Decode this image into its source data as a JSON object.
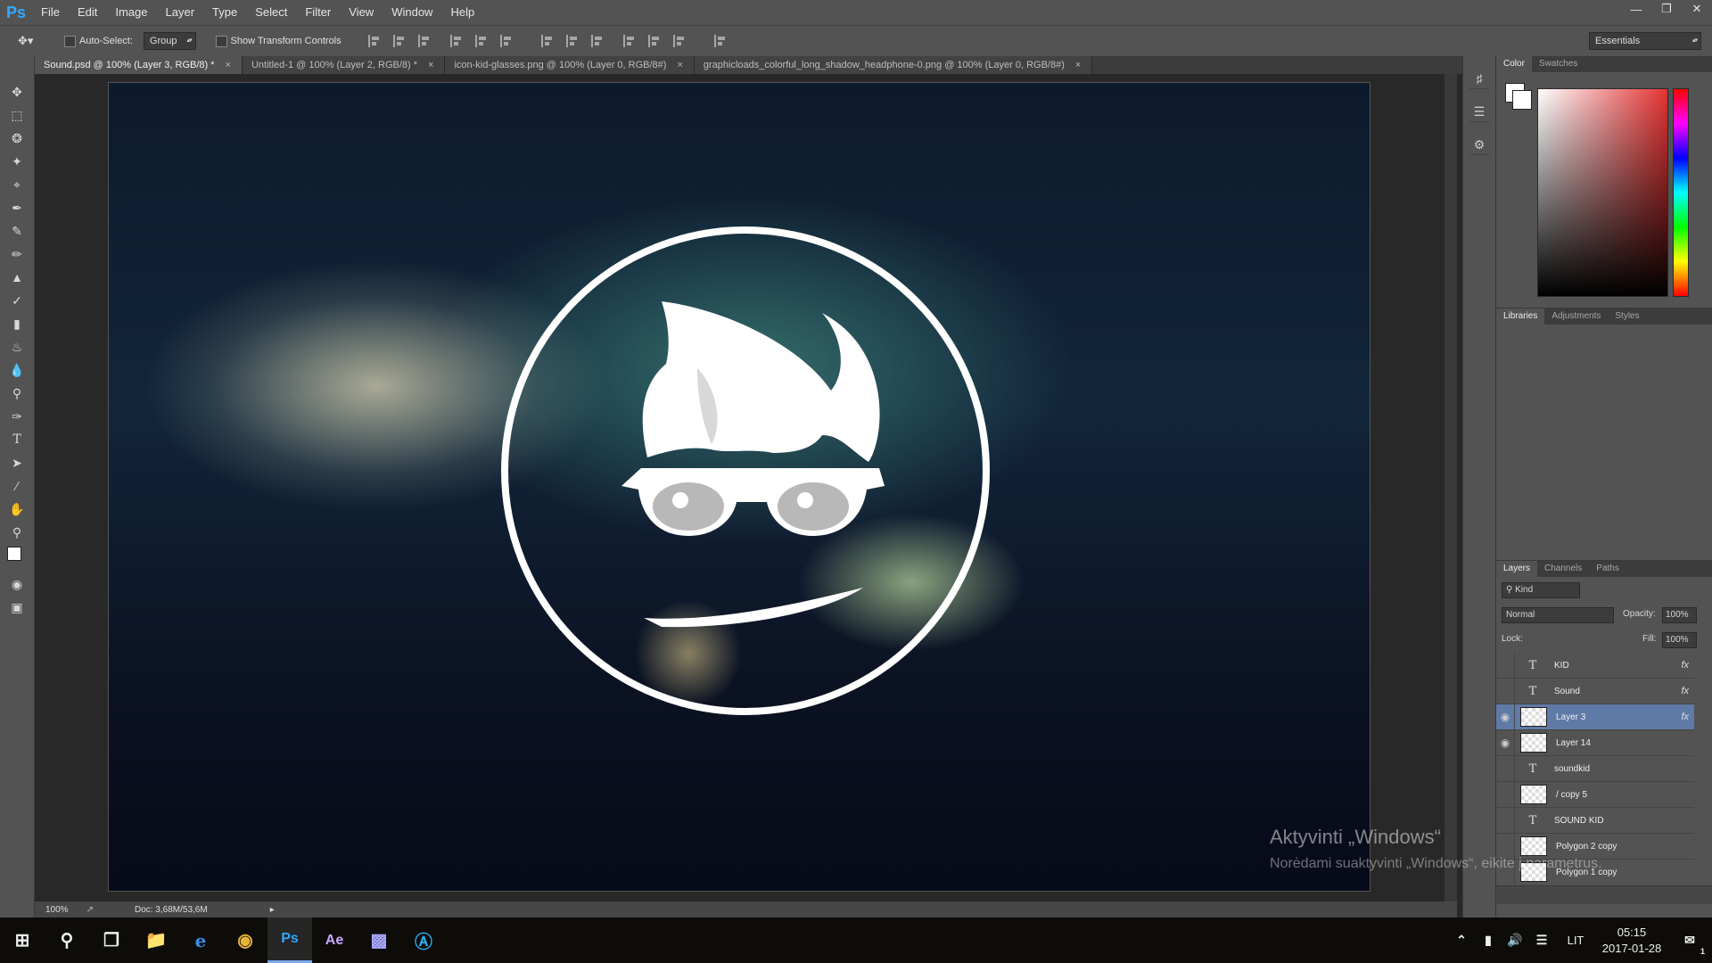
{
  "app": {
    "logo": "Ps"
  },
  "menu": [
    "File",
    "Edit",
    "Image",
    "Layer",
    "Type",
    "Select",
    "Filter",
    "View",
    "Window",
    "Help"
  ],
  "options_bar": {
    "auto_select_label": "Auto-Select:",
    "auto_select_value": "Group",
    "show_transform_label": "Show Transform Controls",
    "workspace": "Essentials"
  },
  "tabs": [
    {
      "label": "Sound.psd @ 100% (Layer 3, RGB/8) *",
      "active": true
    },
    {
      "label": "Untitled-1 @ 100% (Layer 2, RGB/8) *",
      "active": false
    },
    {
      "label": "icon-kid-glasses.png @ 100% (Layer 0, RGB/8#)",
      "active": false
    },
    {
      "label": "graphicloads_colorful_long_shadow_headphone-0.png @ 100% (Layer 0, RGB/8#)",
      "active": false
    }
  ],
  "tab_close_glyph": "×",
  "status": {
    "zoom": "100%",
    "doc": "Doc: 3,68M/53,6M"
  },
  "color_panel": {
    "tabs": [
      "Color",
      "Swatches"
    ]
  },
  "lib_panel": {
    "tabs": [
      "Libraries",
      "Adjustments",
      "Styles"
    ]
  },
  "layers_panel": {
    "tabs": [
      "Layers",
      "Channels",
      "Paths"
    ],
    "kind": "Kind",
    "blend_mode": "Normal",
    "opacity_label": "Opacity:",
    "opacity": "100%",
    "lock_label": "Lock:",
    "fill_label": "Fill:",
    "fill": "100%",
    "layers": [
      {
        "name": "KID",
        "type": "text",
        "visible": false,
        "fx": true,
        "selected": false
      },
      {
        "name": "Sound",
        "type": "text",
        "visible": false,
        "fx": true,
        "selected": false
      },
      {
        "name": "Layer 3",
        "type": "pixel",
        "visible": true,
        "fx": true,
        "selected": true
      },
      {
        "name": "Layer 14",
        "type": "pixel",
        "visible": true,
        "fx": false,
        "selected": false
      },
      {
        "name": "soundkid",
        "type": "text",
        "visible": false,
        "fx": false,
        "selected": false
      },
      {
        "name": "/ copy 5",
        "type": "pixel",
        "visible": false,
        "fx": false,
        "selected": false
      },
      {
        "name": "SOUND KID",
        "type": "text",
        "visible": false,
        "fx": false,
        "selected": false
      },
      {
        "name": "Polygon 2 copy",
        "type": "pixel",
        "visible": false,
        "fx": false,
        "selected": false
      },
      {
        "name": "Polygon 1 copy",
        "type": "pixel",
        "visible": false,
        "fx": false,
        "selected": false
      }
    ],
    "fx_glyph": "fx",
    "text_glyph": "T"
  },
  "watermark": {
    "line1": "Aktyvinti „Windows“",
    "line2": "Norėdami suaktyvinti „Windows“, eikite į parametrus."
  },
  "taskbar": {
    "language": "LIT",
    "time": "05:15",
    "date": "2017-01-28",
    "notifications": "1",
    "ae_label": "Ae",
    "ps_label": "Ps"
  },
  "colors": {
    "accent": "#31a8ff",
    "selected_layer": "#5f7aa6"
  }
}
